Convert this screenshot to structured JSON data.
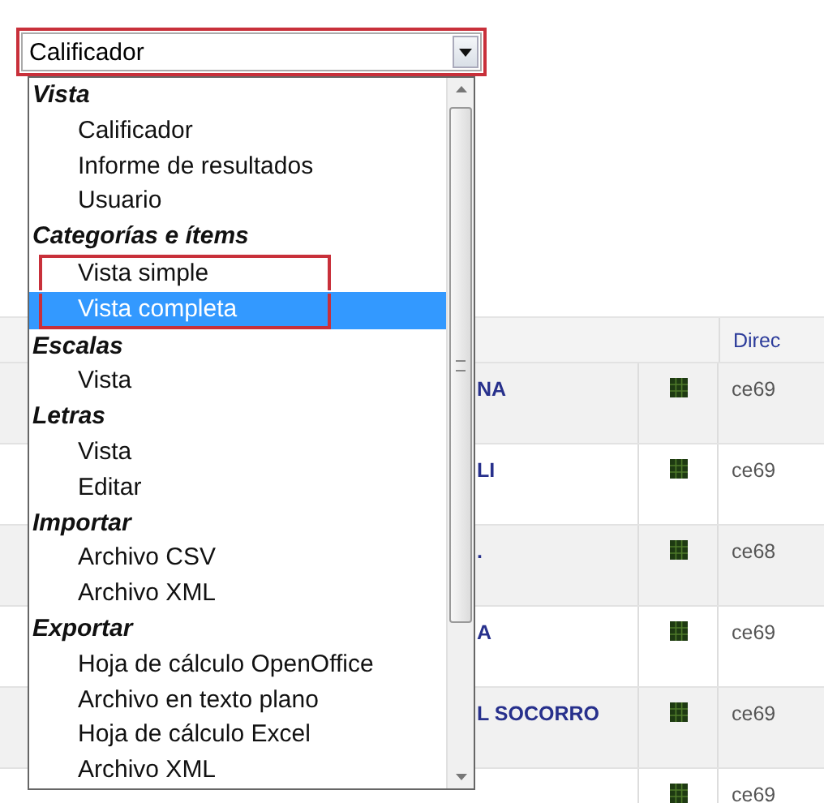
{
  "select": {
    "value": "Calificador",
    "annotated": true
  },
  "menu": {
    "groups": [
      {
        "label": "Vista",
        "items": [
          {
            "label": "Calificador",
            "selected": false,
            "framed": false
          },
          {
            "label": "Informe de resultados",
            "selected": false,
            "framed": false
          },
          {
            "label": "Usuario",
            "selected": false,
            "framed": false
          }
        ]
      },
      {
        "label": "Categorías e ítems",
        "items": [
          {
            "label": "Vista simple",
            "selected": false,
            "framed": true
          },
          {
            "label": "Vista completa",
            "selected": true,
            "framed": true
          }
        ]
      },
      {
        "label": "Escalas",
        "items": [
          {
            "label": "Vista",
            "selected": false,
            "framed": false
          }
        ]
      },
      {
        "label": "Letras",
        "items": [
          {
            "label": "Vista",
            "selected": false,
            "framed": false
          },
          {
            "label": "Editar",
            "selected": false,
            "framed": false
          }
        ]
      },
      {
        "label": "Importar",
        "items": [
          {
            "label": "Archivo CSV",
            "selected": false,
            "framed": false
          },
          {
            "label": "Archivo XML",
            "selected": false,
            "framed": false
          }
        ]
      },
      {
        "label": "Exportar",
        "items": [
          {
            "label": "Hoja de cálculo OpenOffice",
            "selected": false,
            "framed": false
          },
          {
            "label": "Archivo en texto plano",
            "selected": false,
            "framed": false
          },
          {
            "label": "Hoja de cálculo Excel",
            "selected": false,
            "framed": false
          },
          {
            "label": "Archivo XML",
            "selected": false,
            "framed": false
          }
        ]
      }
    ]
  },
  "table": {
    "column_3": "Direc",
    "rows": [
      {
        "name": "NA",
        "address": "ce69"
      },
      {
        "name": "LI",
        "address": "ce69"
      },
      {
        "name": ".",
        "address": "ce68"
      },
      {
        "name": "A",
        "address": "ce69"
      },
      {
        "name": "L SOCORRO",
        "address": "ce69"
      },
      {
        "address": "ce69"
      }
    ]
  }
}
